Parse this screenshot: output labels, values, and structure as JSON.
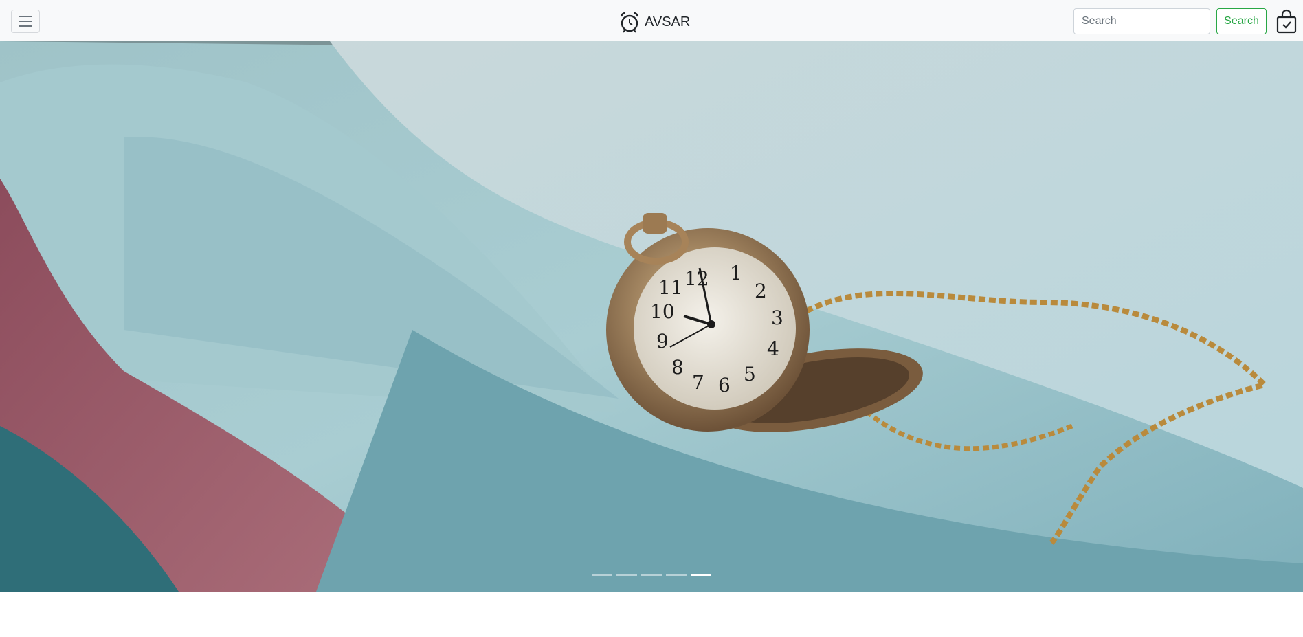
{
  "navbar": {
    "brand_name": "AVSAR",
    "brand_icon": "alarm-clock-icon",
    "menu_icon": "hamburger-menu-icon",
    "cart_icon": "shopping-bag-check-icon",
    "search": {
      "placeholder": "Search",
      "value": "",
      "button_label": "Search"
    },
    "colors": {
      "background": "#f8f9fa",
      "search_button": "#28a745"
    }
  },
  "carousel": {
    "slide_count": 5,
    "active_index": 4,
    "image_description_icon": "pocket-watch-photo"
  },
  "section": {
    "heading": ""
  }
}
